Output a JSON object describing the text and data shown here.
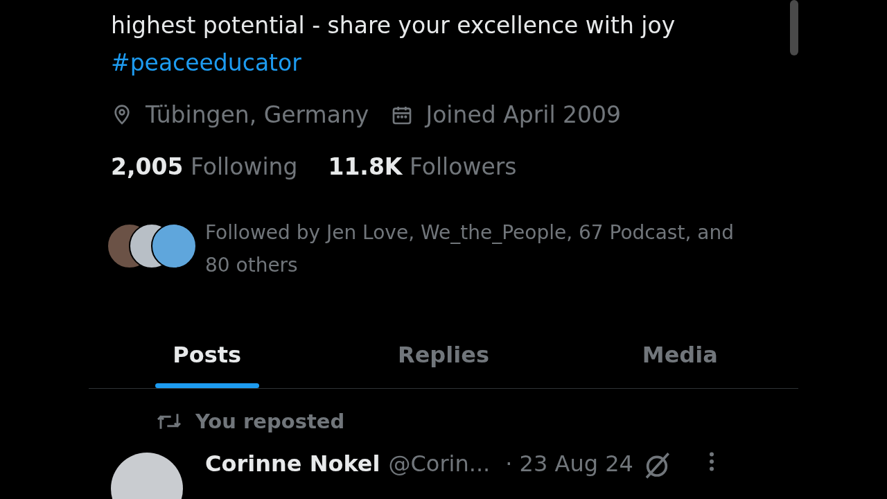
{
  "bio": {
    "text": "highest potential - share your excellence with joy",
    "hashtag": "#peaceeducator"
  },
  "meta": [
    {
      "kind": "location",
      "label": "Tübingen, Germany"
    },
    {
      "kind": "joined",
      "label": "Joined April 2009"
    }
  ],
  "stats": [
    {
      "count": "2,005",
      "label": "Following"
    },
    {
      "count": "11.8K",
      "label": "Followers"
    }
  ],
  "followed_by": {
    "text": "Followed by Jen Love, We_the_People, 67 Podcast, and 80 others"
  },
  "tabs": [
    {
      "label": "Posts",
      "selected": true
    },
    {
      "label": "Replies",
      "selected": false
    },
    {
      "label": "Media",
      "selected": false
    }
  ],
  "post": {
    "context": "You reposted",
    "name": "Corinne Nokel",
    "handle": "@Corin...",
    "date": "· 23 Aug 24"
  }
}
